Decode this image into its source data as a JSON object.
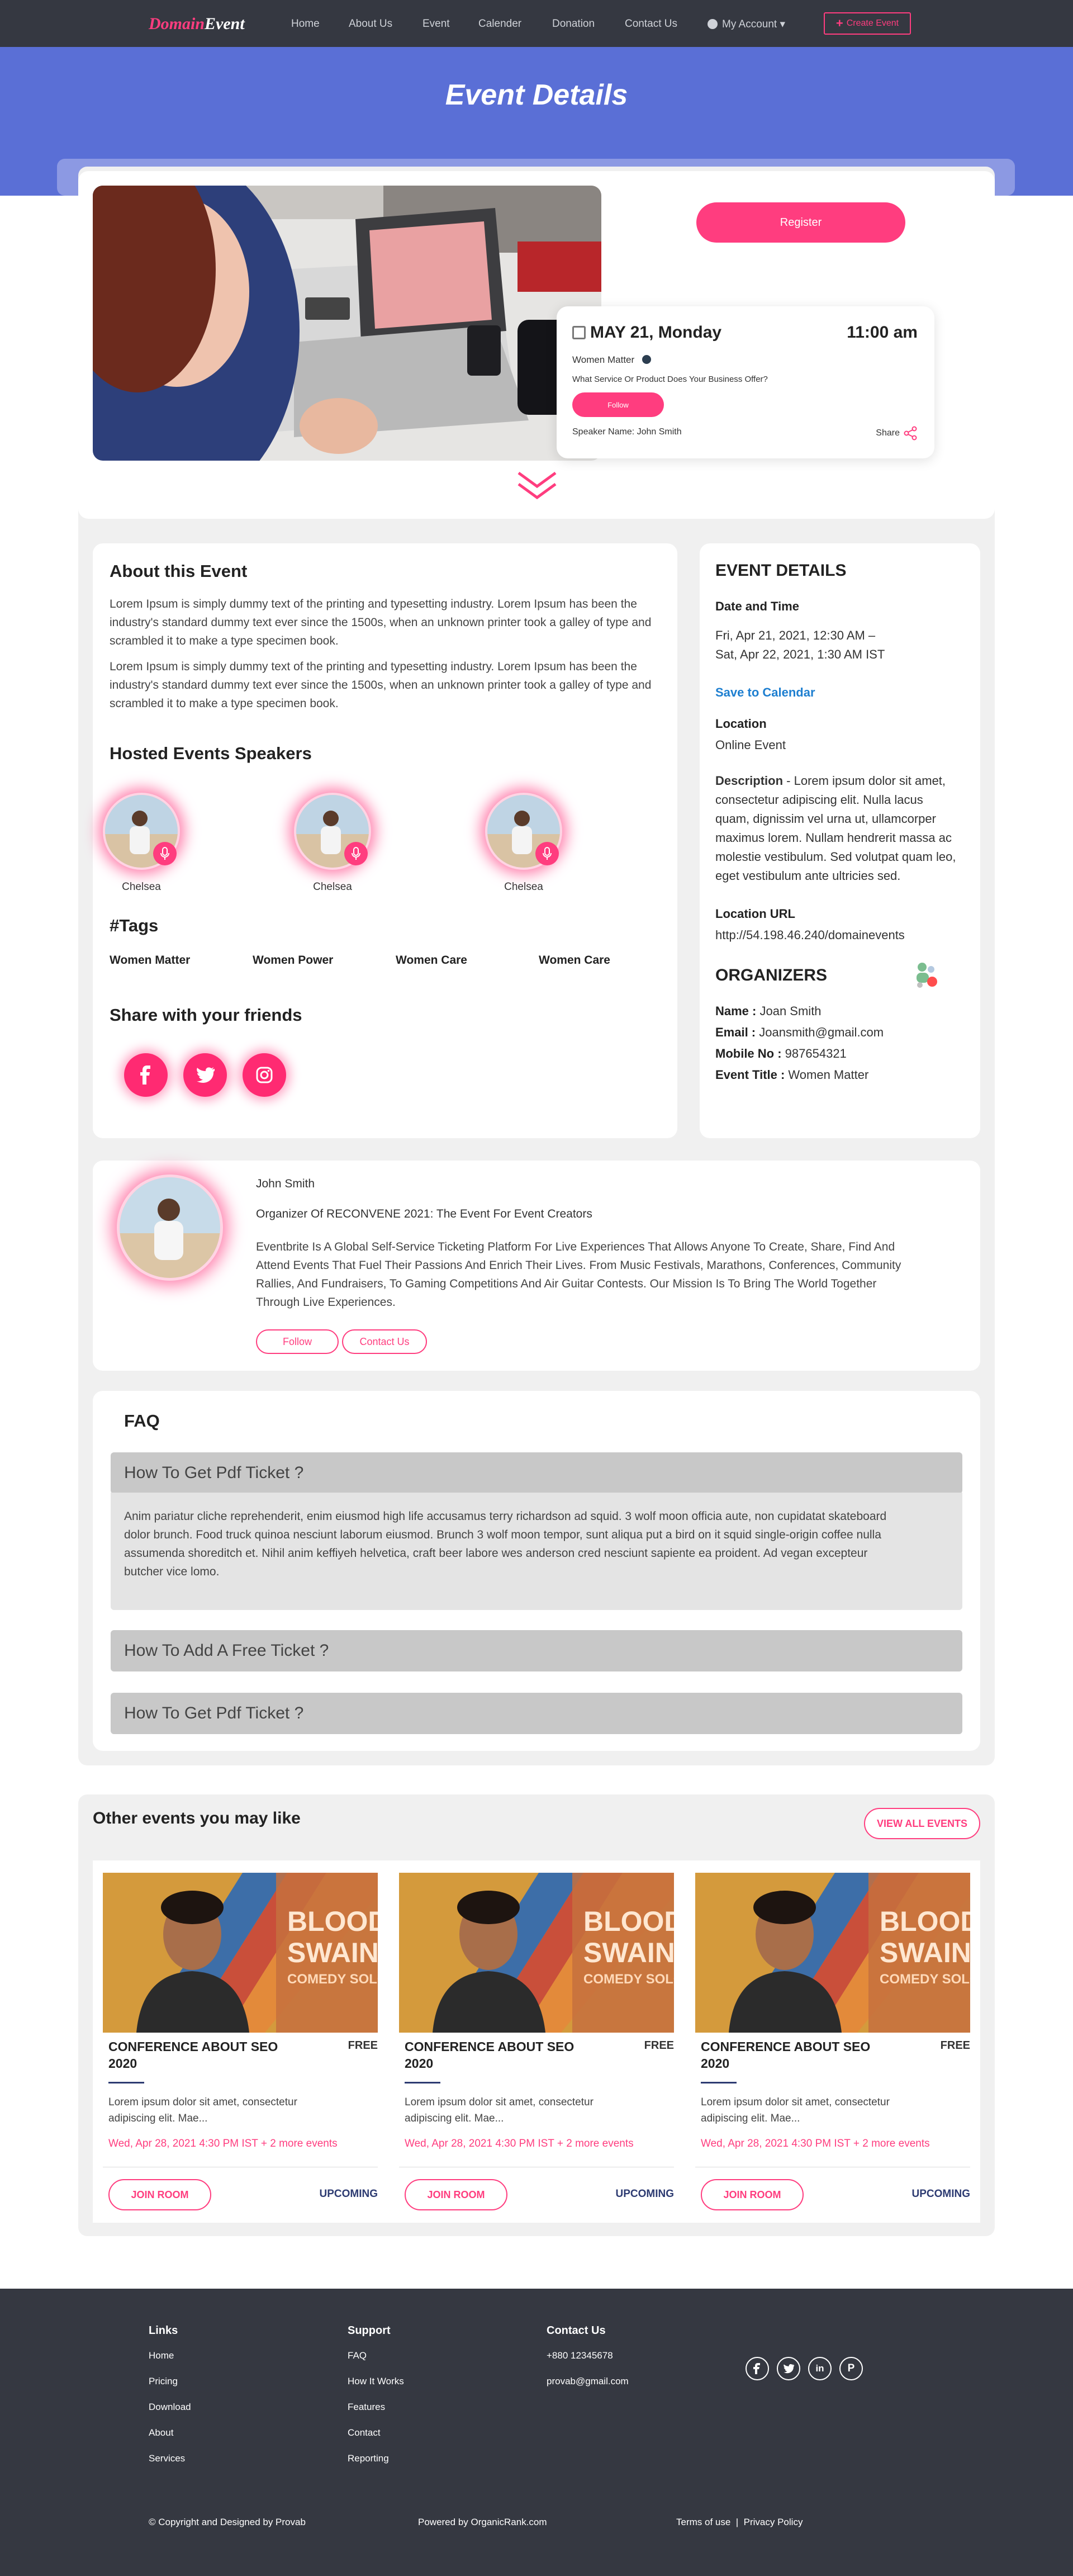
{
  "nav": {
    "logo_a": "Domain",
    "logo_b": "Event",
    "items": [
      "Home",
      "About Us",
      "Event",
      "Calender",
      "Donation",
      "Contact Us"
    ],
    "account": "My Account",
    "create": "Create Event"
  },
  "hero": {
    "title": "Event Details"
  },
  "event_box": {
    "register": "Register",
    "date": "MAY 21, Monday",
    "time": "11:00 am",
    "category": "Women Matter",
    "question": "What Service Or Product Does Your Business Offer?",
    "follow": "Follow",
    "speaker": "Speaker Name: John Smith",
    "share": "Share"
  },
  "about": {
    "title": "About this Event",
    "p1": "Lorem Ipsum is simply dummy text of the printing and typesetting industry. Lorem Ipsum has been the industry's standard dummy text ever since the 1500s, when an unknown printer took a galley of type and scrambled it to make a type specimen book.",
    "p2": "Lorem Ipsum is simply dummy text of the printing and typesetting industry. Lorem Ipsum has been the industry's standard dummy text ever since the 1500s, when an unknown printer took a galley of type and scrambled it to make a type specimen book."
  },
  "speakers": {
    "title": "Hosted Events Speakers",
    "names": [
      "Chelsea",
      "Chelsea",
      "Chelsea"
    ]
  },
  "tags": {
    "title": "#Tags",
    "items": [
      "Women Matter",
      "Women Power",
      "Women Care",
      "Women Care"
    ]
  },
  "share": {
    "title": "Share with your friends"
  },
  "details": {
    "title": "EVENT DETAILS",
    "date_label": "Date and Time",
    "date_line1": "Fri, Apr 21, 2021, 12:30 AM –",
    "date_line2": "Sat, Apr 22, 2021, 1:30 AM IST",
    "save": "Save to Calendar",
    "location_label": "Location",
    "location": "Online Event",
    "desc_label": "Description",
    "desc_lines": [
      "- Lorem ipsum dolor sit amet,",
      "consectetur adipiscing elit. Nulla lacus",
      "quam, dignissim vel urna ut, ullamcorper",
      "maximus lorem. Nullam hendrerit massa ac",
      "molestie vestibulum. Sed volutpat quam leo,",
      "eget vestibulum ante ultricies sed."
    ],
    "url_label": "Location URL",
    "url": "http://54.198.46.240/domainevents"
  },
  "organizers": {
    "title": "ORGANIZERS",
    "name_label": "Name :",
    "name": "Joan Smith",
    "email_label": "Email :",
    "email": "Joansmith@gmail.com",
    "mobile_label": "Mobile No :",
    "mobile": "987654321",
    "event_label": "Event Title :",
    "event": "Women Matter"
  },
  "organizer_card": {
    "name": "John Smith",
    "role": "Organizer Of RECONVENE 2021: The Event For Event Creators",
    "bio_lines": [
      "Eventbrite Is A Global Self-Service Ticketing Platform For Live Experiences That Allows Anyone To Create, Share, Find And",
      "Attend Events That Fuel Their Passions And Enrich Their Lives. From Music Festivals, Marathons, Conferences, Community",
      "Rallies, And Fundraisers, To Gaming Competitions And Air Guitar Contests. Our Mission Is To Bring The World Together",
      "Through Live Experiences."
    ],
    "follow": "Follow",
    "contact": "Contact Us"
  },
  "faq": {
    "title": "FAQ",
    "q1": "How To Get Pdf Ticket ?",
    "a1_lines": [
      "Anim pariatur cliche reprehenderit, enim eiusmod high life accusamus terry richardson ad squid. 3 wolf moon officia aute, non cupidatat skateboard",
      "dolor brunch. Food truck quinoa nesciunt laborum eiusmod. Brunch 3 wolf moon tempor, sunt aliqua put a bird on it squid single-origin coffee nulla",
      "assumenda shoreditch et. Nihil anim keffiyeh helvetica, craft beer labore wes anderson cred nesciunt sapiente ea proident. Ad vegan excepteur",
      "butcher vice lomo."
    ],
    "q2": "How To Add A Free Ticket ?",
    "q3": "How To Get Pdf Ticket ?"
  },
  "others": {
    "title": "Other events you may like",
    "view_all": "VIEW ALL EVENTS",
    "events": [
      {
        "img1": "BLOODY",
        "img2": "SWAIN",
        "img3": "COMEDY SOLO",
        "title_l1": "CONFERENCE ABOUT SEO",
        "title_l2": "2020",
        "price": "FREE",
        "desc_l1": "Lorem ipsum dolor sit amet, consectetur",
        "desc_l2": "adipiscing elit. Mae...",
        "date": "Wed, Apr 28, 2021 4:30 PM IST + 2 more events",
        "join": "JOIN ROOM",
        "status": "UPCOMING"
      },
      {
        "img1": "BLOODY",
        "img2": "SWAIN",
        "img3": "COMEDY SOLO",
        "title_l1": "CONFERENCE ABOUT SEO",
        "title_l2": "2020",
        "price": "FREE",
        "desc_l1": "Lorem ipsum dolor sit amet, consectetur",
        "desc_l2": "adipiscing elit. Mae...",
        "date": "Wed, Apr 28, 2021 4:30 PM IST + 2 more events",
        "join": "JOIN ROOM",
        "status": "UPCOMING"
      },
      {
        "img1": "BLOODY",
        "img2": "SWAIN",
        "img3": "COMEDY SOLO",
        "title_l1": "CONFERENCE ABOUT SEO",
        "title_l2": "2020",
        "price": "FREE",
        "desc_l1": "Lorem ipsum dolor sit amet, consectetur",
        "desc_l2": "adipiscing elit. Mae...",
        "date": "Wed, Apr 28, 2021 4:30 PM IST + 2 more events",
        "join": "JOIN ROOM",
        "status": "UPCOMING"
      }
    ]
  },
  "footer": {
    "links_title": "Links",
    "links": [
      "Home",
      "Pricing",
      "Download",
      "About",
      "Services"
    ],
    "support_title": "Support",
    "support": [
      "FAQ",
      "How It Works",
      "Features",
      "Contact",
      "Reporting"
    ],
    "contact_title": "Contact Us",
    "phone": "+880 12345678",
    "email": "provab@gmail.com",
    "copyright": "© Copyright and Designed by Provab",
    "powered": "Powered by OrganicRank.com",
    "terms": "Terms of use",
    "sep": "|",
    "privacy": "Privacy Policy"
  },
  "icons": [
    "calendar-icon",
    "share-icon",
    "chevron-down-icon",
    "mic-icon",
    "facebook-icon",
    "twitter-icon",
    "instagram-icon",
    "linkedin-icon",
    "pinterest-icon",
    "user-icon",
    "plus-icon"
  ],
  "colors": {
    "accent": "#ff3d7f",
    "hero": "#5a6fd6",
    "nav": "#353841",
    "link": "#1e7fd0",
    "navy": "#2d3b72"
  }
}
